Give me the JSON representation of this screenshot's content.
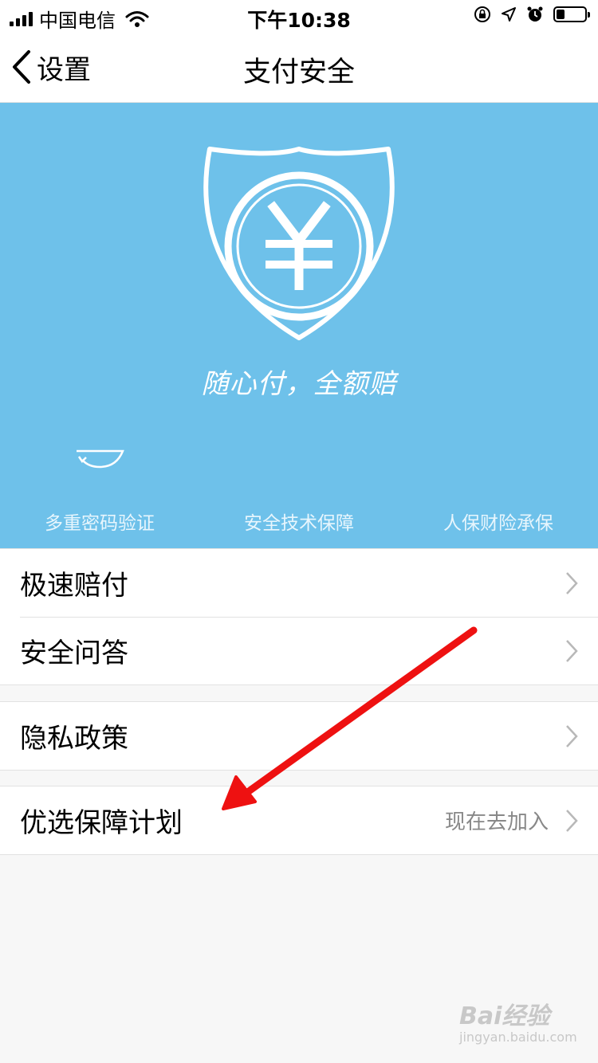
{
  "status_bar": {
    "carrier": "中国电信",
    "time": "下午10:38",
    "battery_level": 0.3
  },
  "nav": {
    "back_label": "设置",
    "title": "支付安全"
  },
  "hero": {
    "slogan": "随心付，全额赔",
    "features": [
      "多重密码验证",
      "安全技术保障",
      "人保财险承保"
    ]
  },
  "menu": {
    "fast_claim": "极速赔付",
    "security_qa": "安全问答",
    "privacy_policy": "隐私政策",
    "guarantee_plan": "优选保障计划",
    "guarantee_plan_value": "现在去加入"
  },
  "watermark": {
    "main": "Bai经验",
    "sub": "jingyan.baidu.com"
  },
  "colors": {
    "hero_bg": "#6ec1ea",
    "annotation_arrow": "#ee1111",
    "secondary_text": "#888888"
  },
  "icons": [
    "signal-icon",
    "wifi-icon",
    "rotation-lock-icon",
    "location-icon",
    "alarm-icon",
    "battery-icon",
    "back-chevron-icon",
    "shield-yuan-icon",
    "refresh-icon",
    "chevron-right-icon"
  ]
}
